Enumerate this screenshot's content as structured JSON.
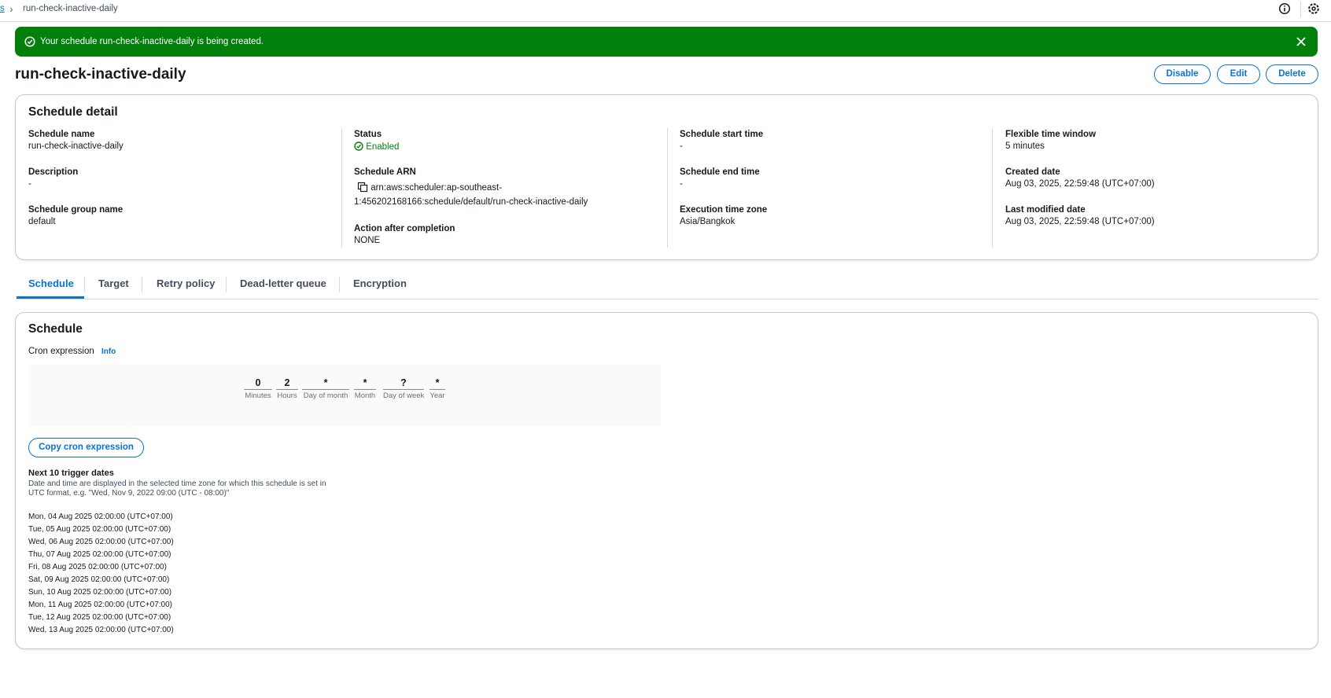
{
  "breadcrumb": {
    "parent": "s",
    "current": "run-check-inactive-daily"
  },
  "flash": {
    "message": "Your schedule run-check-inactive-daily is being created."
  },
  "page": {
    "title": "run-check-inactive-daily"
  },
  "actions": {
    "disable": "Disable",
    "edit": "Edit",
    "delete": "Delete"
  },
  "detail": {
    "title": "Schedule detail",
    "schedule_name_label": "Schedule name",
    "schedule_name": "run-check-inactive-daily",
    "description_label": "Description",
    "description": "-",
    "group_label": "Schedule group name",
    "group": "default",
    "status_label": "Status",
    "status": "Enabled",
    "arn_label": "Schedule ARN",
    "arn_line1": "arn:aws:scheduler:ap-southeast-",
    "arn_line2": "1:456202168166:schedule/default/run-check-inactive-daily",
    "action_label": "Action after completion",
    "action": "NONE",
    "start_label": "Schedule start time",
    "start": "-",
    "end_label": "Schedule end time",
    "end": "-",
    "tz_label": "Execution time zone",
    "tz": "Asia/Bangkok",
    "flex_label": "Flexible time window",
    "flex": "5 minutes",
    "created_label": "Created date",
    "created": "Aug 03, 2025, 22:59:48 (UTC+07:00)",
    "modified_label": "Last modified date",
    "modified": "Aug 03, 2025, 22:59:48 (UTC+07:00)"
  },
  "tabs": [
    "Schedule",
    "Target",
    "Retry policy",
    "Dead-letter queue",
    "Encryption"
  ],
  "schedule": {
    "title": "Schedule",
    "cron_label": "Cron expression",
    "info": "Info",
    "cron": [
      {
        "value": "0",
        "label": "Minutes"
      },
      {
        "value": "2",
        "label": "Hours"
      },
      {
        "value": "*",
        "label": "Day of month"
      },
      {
        "value": "*",
        "label": "Month"
      },
      {
        "value": "?",
        "label": "Day of week"
      },
      {
        "value": "*",
        "label": "Year"
      }
    ],
    "copy_button": "Copy cron expression",
    "next_title": "Next 10 trigger dates",
    "next_desc_1": "Date and time are displayed in the selected time zone for which this schedule is set in",
    "next_desc_2": "UTC format, e.g. \"Wed, Nov 9, 2022 09:00 (UTC - 08:00)\"",
    "triggers": [
      "Mon, 04 Aug 2025 02:00:00 (UTC+07:00)",
      "Tue, 05 Aug 2025 02:00:00 (UTC+07:00)",
      "Wed, 06 Aug 2025 02:00:00 (UTC+07:00)",
      "Thu, 07 Aug 2025 02:00:00 (UTC+07:00)",
      "Fri, 08 Aug 2025 02:00:00 (UTC+07:00)",
      "Sat, 09 Aug 2025 02:00:00 (UTC+07:00)",
      "Sun, 10 Aug 2025 02:00:00 (UTC+07:00)",
      "Mon, 11 Aug 2025 02:00:00 (UTC+07:00)",
      "Tue, 12 Aug 2025 02:00:00 (UTC+07:00)",
      "Wed, 13 Aug 2025 02:00:00 (UTC+07:00)"
    ]
  },
  "colors": {
    "accent": "#0972d3",
    "success": "#037f0c",
    "border": "#c6c6cd"
  },
  "icons": [
    "chevron-right-icon",
    "info-circle-icon",
    "settings-icon",
    "check-circle-icon",
    "close-icon",
    "copy-icon"
  ]
}
